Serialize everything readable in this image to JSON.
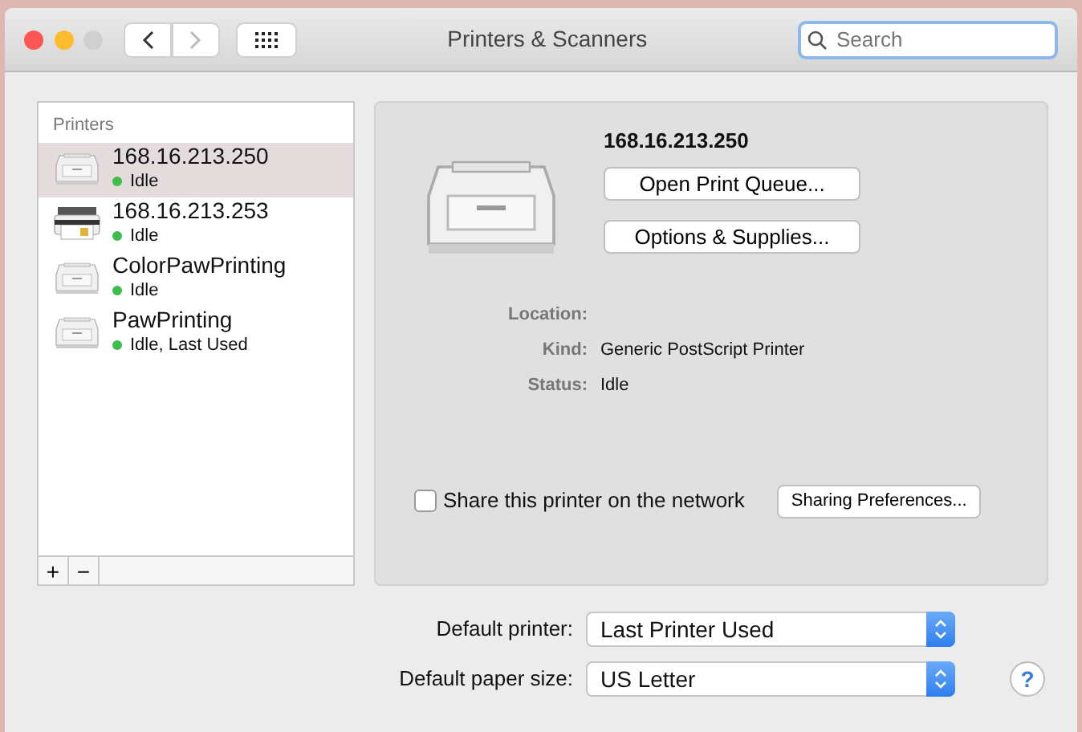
{
  "window": {
    "title": "Printers & Scanners"
  },
  "toolbar": {
    "back_disabled": false,
    "forward_disabled": true
  },
  "search": {
    "placeholder": "Search"
  },
  "sidebar": {
    "heading": "Printers",
    "items": [
      {
        "name": "168.16.213.250",
        "status": "Idle",
        "kind": "laser",
        "selected": true
      },
      {
        "name": "168.16.213.253",
        "status": "Idle",
        "kind": "inkjet",
        "selected": false
      },
      {
        "name": "ColorPawPrinting",
        "status": "Idle",
        "kind": "laser",
        "selected": false
      },
      {
        "name": "PawPrinting",
        "status": "Idle, Last Used",
        "kind": "laser",
        "selected": false
      }
    ],
    "footer_buttons": [
      "+",
      "−"
    ]
  },
  "detail": {
    "printer_name": "168.16.213.250",
    "buttons": [
      "Open Print Queue...",
      "Options & Supplies..."
    ],
    "fields": [
      {
        "label": "Location:"
      },
      {
        "label": "Kind:",
        "value": "Generic PostScript Printer"
      },
      {
        "label": "Status:",
        "value": "Idle"
      }
    ],
    "share": {
      "label": "Share this printer on the network",
      "checked": false
    },
    "sharing_button": "Sharing Preferences..."
  },
  "defaults": [
    {
      "label": "Default printer:",
      "value": "Last Printer Used"
    },
    {
      "label": "Default paper size:",
      "value": "US Letter"
    }
  ],
  "help": "?"
}
